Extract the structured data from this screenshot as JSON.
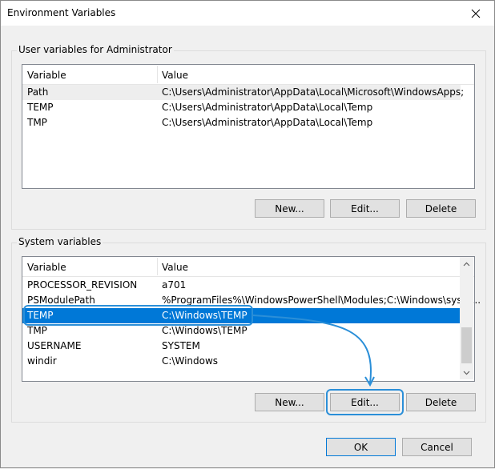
{
  "window": {
    "title": "Environment Variables"
  },
  "user_group": {
    "legend": "User variables for Administrator",
    "columns": [
      "Variable",
      "Value"
    ],
    "rows": [
      {
        "variable": "Path",
        "value": "C:\\Users\\Administrator\\AppData\\Local\\Microsoft\\WindowsApps;"
      },
      {
        "variable": "TEMP",
        "value": "C:\\Users\\Administrator\\AppData\\Local\\Temp"
      },
      {
        "variable": "TMP",
        "value": "C:\\Users\\Administrator\\AppData\\Local\\Temp"
      }
    ],
    "buttons": {
      "new": "New...",
      "edit": "Edit...",
      "delete": "Delete"
    }
  },
  "system_group": {
    "legend": "System variables",
    "columns": [
      "Variable",
      "Value"
    ],
    "rows": [
      {
        "variable": "PROCESSOR_REVISION",
        "value": "a701"
      },
      {
        "variable": "PSModulePath",
        "value": "%ProgramFiles%\\WindowsPowerShell\\Modules;C:\\Windows\\syste..."
      },
      {
        "variable": "TEMP",
        "value": "C:\\Windows\\TEMP"
      },
      {
        "variable": "TMP",
        "value": "C:\\Windows\\TEMP"
      },
      {
        "variable": "USERNAME",
        "value": "SYSTEM"
      },
      {
        "variable": "windir",
        "value": "C:\\Windows"
      }
    ],
    "selected_row": "TEMP",
    "buttons": {
      "new": "New...",
      "edit": "Edit...",
      "delete": "Delete"
    }
  },
  "footer": {
    "ok": "OK",
    "cancel": "Cancel"
  },
  "colors": {
    "selection": "#0078d7",
    "annotation": "#2b8fd8"
  },
  "icons": [
    "close-icon",
    "scroll-up-arrow-icon",
    "scroll-down-arrow-icon"
  ]
}
